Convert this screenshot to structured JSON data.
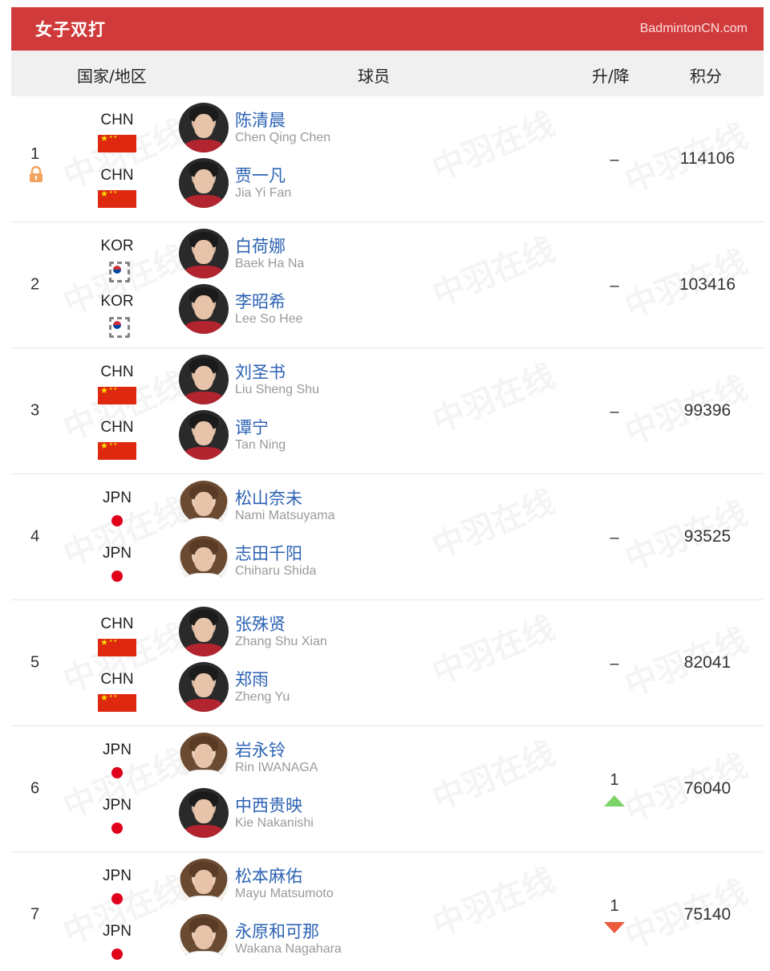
{
  "header": {
    "title": "女子双打",
    "brand": "BadmintonCN.com",
    "bg_color": "#d03a3a"
  },
  "columns": {
    "country": "国家/地区",
    "player": "球员",
    "change": "升/降",
    "points": "积分"
  },
  "watermark": "中羽在线",
  "rankings": [
    {
      "rank": "1",
      "locked": true,
      "change": "–",
      "change_dir": "none",
      "points": "114106",
      "players": [
        {
          "country": "CHN",
          "flag": "cn",
          "name_cn": "陈清晨",
          "name_en": "Chen Qing Chen",
          "avatar_tone": "dark"
        },
        {
          "country": "CHN",
          "flag": "cn",
          "name_cn": "贾一凡",
          "name_en": "Jia Yi Fan",
          "avatar_tone": "dark"
        }
      ]
    },
    {
      "rank": "2",
      "locked": false,
      "change": "–",
      "change_dir": "none",
      "points": "103416",
      "players": [
        {
          "country": "KOR",
          "flag": "kr",
          "name_cn": "白荷娜",
          "name_en": "Baek Ha Na",
          "avatar_tone": "dark"
        },
        {
          "country": "KOR",
          "flag": "kr",
          "name_cn": "李昭希",
          "name_en": "Lee So Hee",
          "avatar_tone": "dark"
        }
      ]
    },
    {
      "rank": "3",
      "locked": false,
      "change": "–",
      "change_dir": "none",
      "points": "99396",
      "players": [
        {
          "country": "CHN",
          "flag": "cn",
          "name_cn": "刘圣书",
          "name_en": "Liu Sheng Shu",
          "avatar_tone": "dark"
        },
        {
          "country": "CHN",
          "flag": "cn",
          "name_cn": "谭宁",
          "name_en": "Tan Ning",
          "avatar_tone": "dark"
        }
      ]
    },
    {
      "rank": "4",
      "locked": false,
      "change": "–",
      "change_dir": "none",
      "points": "93525",
      "players": [
        {
          "country": "JPN",
          "flag": "jp",
          "name_cn": "松山奈未",
          "name_en": "Nami Matsuyama",
          "avatar_tone": "light"
        },
        {
          "country": "JPN",
          "flag": "jp",
          "name_cn": "志田千阳",
          "name_en": "Chiharu Shida",
          "avatar_tone": "light"
        }
      ]
    },
    {
      "rank": "5",
      "locked": false,
      "change": "–",
      "change_dir": "none",
      "points": "82041",
      "players": [
        {
          "country": "CHN",
          "flag": "cn",
          "name_cn": "张殊贤",
          "name_en": "Zhang Shu Xian",
          "avatar_tone": "dark"
        },
        {
          "country": "CHN",
          "flag": "cn",
          "name_cn": "郑雨",
          "name_en": "Zheng Yu",
          "avatar_tone": "dark"
        }
      ]
    },
    {
      "rank": "6",
      "locked": false,
      "change": "1",
      "change_dir": "up",
      "points": "76040",
      "players": [
        {
          "country": "JPN",
          "flag": "jp",
          "name_cn": "岩永铃",
          "name_en": "Rin IWANAGA",
          "avatar_tone": "light"
        },
        {
          "country": "JPN",
          "flag": "jp",
          "name_cn": "中西贵映",
          "name_en": "Kie Nakanishi",
          "avatar_tone": "dark"
        }
      ]
    },
    {
      "rank": "7",
      "locked": false,
      "change": "1",
      "change_dir": "down",
      "points": "75140",
      "players": [
        {
          "country": "JPN",
          "flag": "jp",
          "name_cn": "松本麻佑",
          "name_en": "Mayu Matsumoto",
          "avatar_tone": "light"
        },
        {
          "country": "JPN",
          "flag": "jp",
          "name_cn": "永原和可那",
          "name_en": "Wakana Nagahara",
          "avatar_tone": "light"
        }
      ]
    }
  ]
}
